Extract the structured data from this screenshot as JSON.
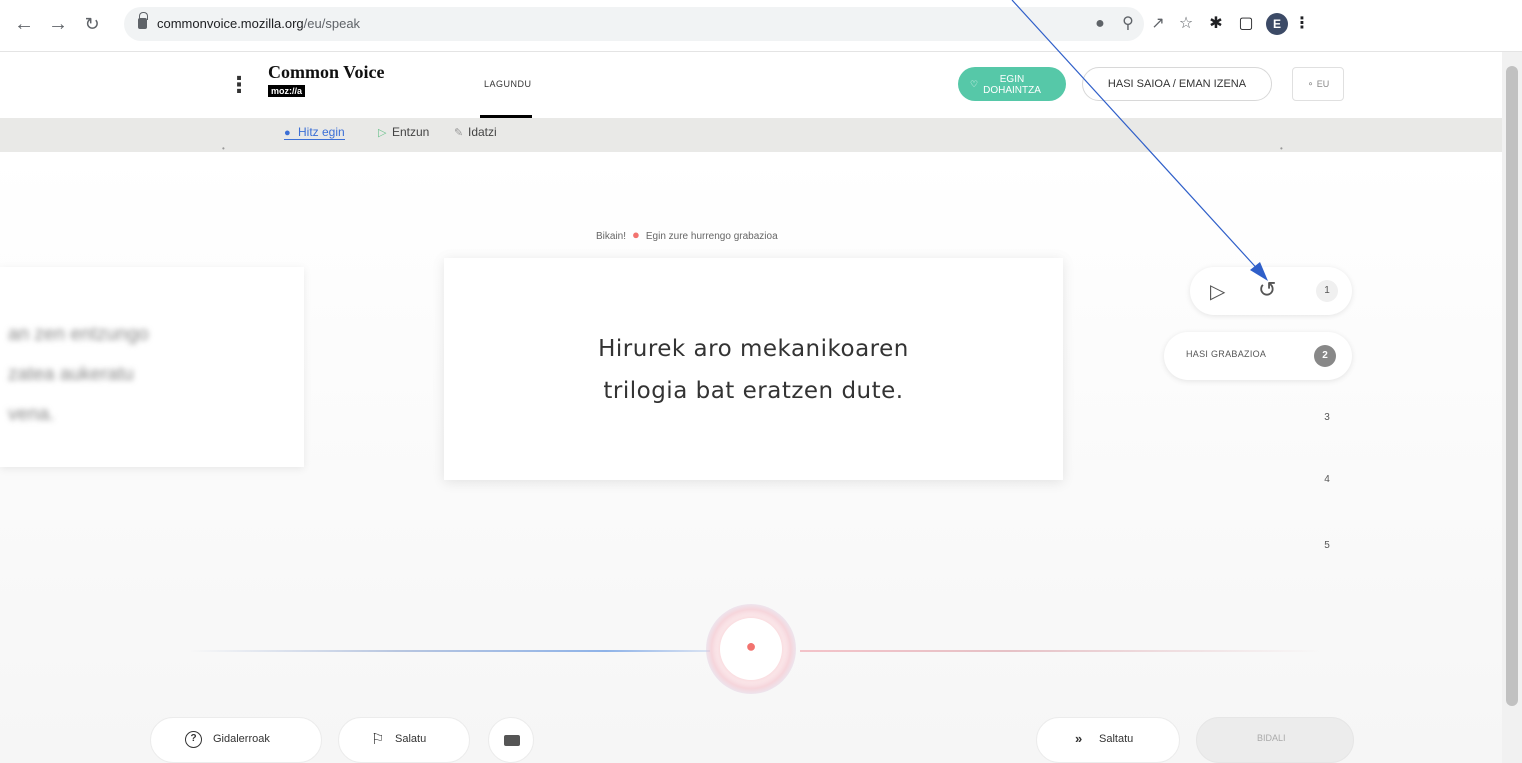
{
  "browser": {
    "url_host": "commonvoice.mozilla.org",
    "url_path": "/eu/speak",
    "profile_initial": "E"
  },
  "header": {
    "logo_title": "Common Voice",
    "logo_sub": "moz://a",
    "nav_help": "LAGUNDU",
    "donate_line1": "EGIN",
    "donate_line2": "DOHAINTZA",
    "login": "HASI SAIOA / EMAN IZENA",
    "lang": "EU"
  },
  "subnav": {
    "speak": "Hitz egin",
    "listen": "Entzun",
    "write": "Idatzi"
  },
  "feedback": {
    "great": "Bikain!",
    "next": "Egin zure hurrengo grabazioa"
  },
  "prev_sentence": "an zen entzungo\nzatea aukeratu\nvena.",
  "sentence": {
    "line1": "Hirurek aro mekanikoaren",
    "line2": "trilogia bat eratzen dute."
  },
  "clips": {
    "n1": "1",
    "n2": "2",
    "start_recording": "HASI GRABAZIOA",
    "n3": "3",
    "n4": "4",
    "n5": "5"
  },
  "footer": {
    "guidelines": "Gidalerroak",
    "report": "Salatu",
    "skip": "Saltatu",
    "submit": "BIDALI"
  },
  "colors": {
    "accent_blue": "#3b6fd6",
    "donate_green": "#56c8a8",
    "mic_red": "#f2736f"
  }
}
